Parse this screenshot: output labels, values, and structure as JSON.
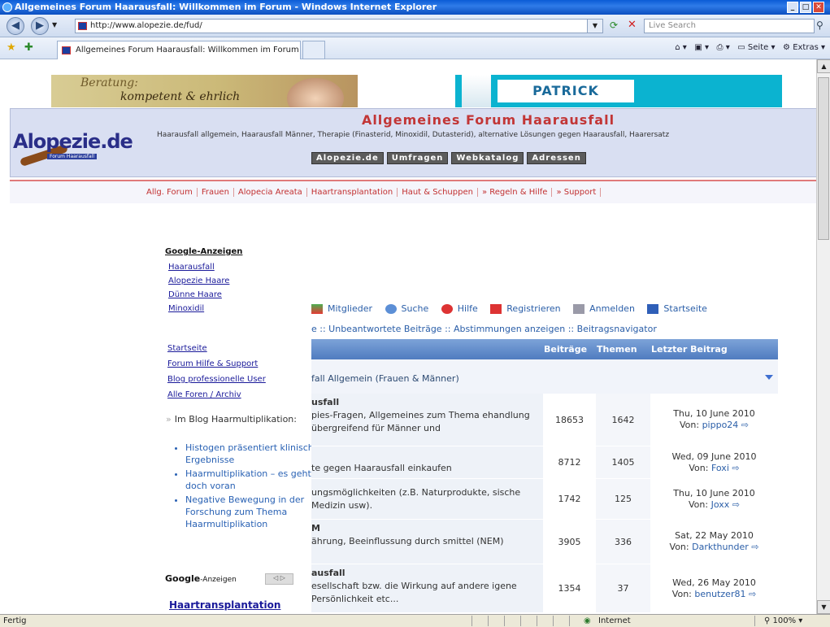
{
  "window": {
    "title": "Allgemeines Forum Haarausfall: Willkommen im Forum - Windows Internet Explorer",
    "url": "http://www.alopezie.de/fud/",
    "search_placeholder": "Live Search",
    "tab_title": "Allgemeines Forum Haarausfall: Willkommen im Forum",
    "cmd_seite": "Seite",
    "cmd_extras": "Extras",
    "status": "Fertig",
    "zone": "Internet",
    "zoom": "100%"
  },
  "banners": {
    "left_line1": "Beratung:",
    "left_line2": "kompetent & ehrlich",
    "right_name": "PATRICK MWAMBA"
  },
  "header": {
    "logo": "Alopezie.de",
    "logo_sub": "Forum Haarausfall",
    "title": "Allgemeines Forum Haarausfall",
    "subtitle": "Haarausfall allgemein, Haarausfall Männer, Therapie (Finasterid, Minoxidil, Dutasterid), alternative Lösungen gegen Haarausfall, Haarersatz",
    "nav": [
      "Alopezie.de",
      "Umfragen",
      "Webkatalog",
      "Adressen"
    ]
  },
  "categories": [
    "Allg. Forum",
    "Frauen",
    "Alopecia Areata",
    "Haartransplantation",
    "Haut & Schuppen",
    "» Regeln & Hilfe",
    "» Support"
  ],
  "google_ads": {
    "heading": "Google-Anzeigen",
    "links": [
      "Haarausfall",
      "Alopezie Haare",
      "Dünne Haare",
      "Minoxidil"
    ]
  },
  "side_links": [
    "Startseite",
    "Forum Hilfe & Support",
    "Blog professionelle User",
    "Alle Foren / Archiv"
  ],
  "blog": {
    "heading": "Im Blog Haarmultiplikation:",
    "items": [
      "Histogen präsentiert klinische Ergebnisse",
      "Haarmultiplikation – es geht doch voran",
      "Negative Bewegung in der Forschung zum Thema Haarmultiplikation"
    ]
  },
  "google_box": {
    "label": "Google",
    "label_suffix": "-Anzeigen",
    "link": "Haartransplantation"
  },
  "toolbar": {
    "items": [
      "Mitglieder",
      "Suche",
      "Hilfe",
      "Registrieren",
      "Anmelden",
      "Startseite"
    ],
    "sublinks": "e :: Unbeantwortete Beiträge :: Abstimmungen anzeigen :: Beitragsnavigator"
  },
  "table": {
    "headers": [
      "Beiträge",
      "Themen",
      "Letzter Beitrag"
    ],
    "category": "fall Allgemein (Frauen & Männer)",
    "rows": [
      {
        "title": "usfall",
        "desc": "pies-Fragen, Allgemeines zum Thema ehandlung übergreifend für Männer und",
        "posts": "18653",
        "topics": "1642",
        "date": "Thu, 10 June 2010",
        "von": "Von:",
        "user": "pippo24"
      },
      {
        "title": "",
        "desc": "te gegen Haarausfall einkaufen",
        "posts": "8712",
        "topics": "1405",
        "date": "Wed, 09 June 2010",
        "von": "Von:",
        "user": "Foxi"
      },
      {
        "title": "",
        "desc": "ungsmöglichkeiten (z.B. Naturprodukte, sische Medizin usw).",
        "posts": "1742",
        "topics": "125",
        "date": "Thu, 10 June 2010",
        "von": "Von:",
        "user": "Joxx"
      },
      {
        "title": "M",
        "desc": "ährung, Beeinflussung durch smittel (NEM)",
        "posts": "3905",
        "topics": "336",
        "date": "Sat, 22 May 2010",
        "von": "Von:",
        "user": "Darkthunder"
      },
      {
        "title": "ausfall",
        "desc": "esellschaft bzw. die Wirkung auf andere igene Persönlichkeit etc...",
        "posts": "1354",
        "topics": "37",
        "date": "Wed, 26 May 2010",
        "von": "Von:",
        "user": "benutzer81"
      }
    ]
  }
}
